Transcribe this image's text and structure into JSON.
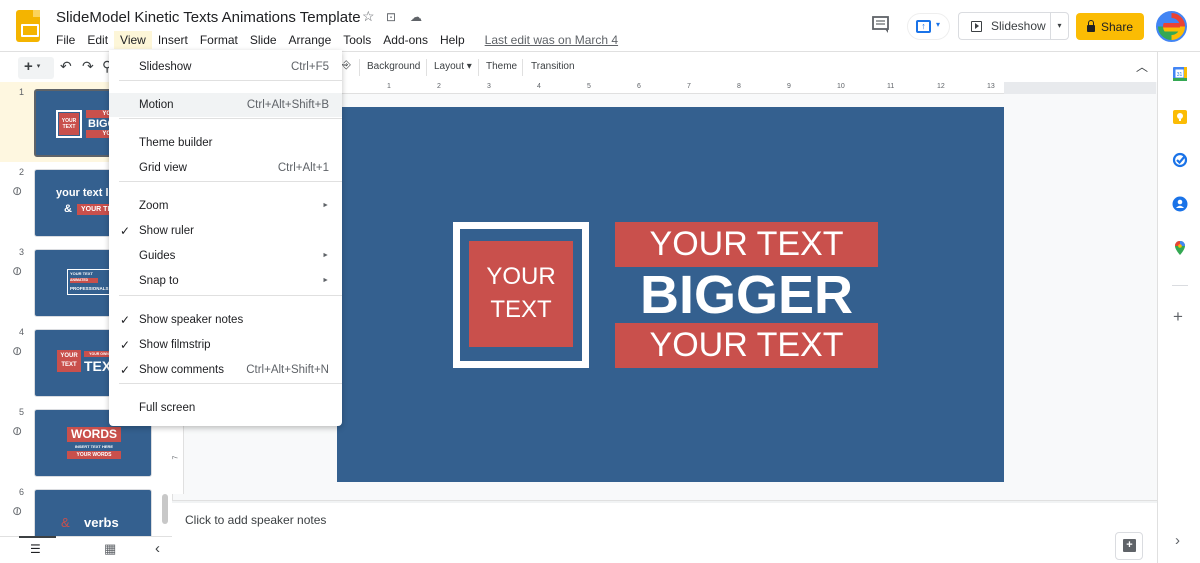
{
  "header": {
    "title": "SlideModel Kinetic Texts Animations Template",
    "title_icons": [
      "star-icon",
      "move-to-folder-icon",
      "cloud-status-icon"
    ],
    "menus": [
      "File",
      "Edit",
      "View",
      "Insert",
      "Format",
      "Slide",
      "Arrange",
      "Tools",
      "Add-ons",
      "Help"
    ],
    "active_menu": "View",
    "last_edit": "Last edit was on March 4",
    "slideshow_label": "Slideshow",
    "share_label": "Share",
    "glyphs": {
      "star": "☆",
      "folder": "⊡",
      "cloud": "☁",
      "comment": "▤",
      "caret": "▾",
      "present_arrow": "↑"
    }
  },
  "toolbar": {
    "new_glyph": "+",
    "new_caret": "▾",
    "undo_glyph": "↶",
    "redo_glyph": "↷",
    "paint_glyph": "⚲",
    "insert_glyph": "⎆",
    "background_label": "Background",
    "layout_label": "Layout ▾",
    "theme_label": "Theme",
    "transition_label": "Transition",
    "collapse_glyph": "︿"
  },
  "ruler": {
    "h_labels": [
      "1",
      "2",
      "3",
      "4",
      "5",
      "6",
      "7",
      "8",
      "9",
      "10",
      "11",
      "12",
      "13"
    ],
    "v_labels": [
      "7"
    ]
  },
  "view_menu": {
    "items": [
      {
        "label": "Slideshow",
        "shortcut": "Ctrl+F5",
        "checked": false,
        "submenu": false
      },
      {
        "label": "Motion",
        "shortcut": "Ctrl+Alt+Shift+B",
        "checked": false,
        "submenu": false,
        "hover": true
      },
      {
        "label": "Theme builder",
        "shortcut": "",
        "checked": false,
        "submenu": false
      },
      {
        "label": "Grid view",
        "shortcut": "Ctrl+Alt+1",
        "checked": false,
        "submenu": false
      },
      {
        "label": "Zoom",
        "shortcut": "",
        "checked": false,
        "submenu": true
      },
      {
        "label": "Show ruler",
        "shortcut": "",
        "checked": true,
        "submenu": false
      },
      {
        "label": "Guides",
        "shortcut": "",
        "checked": false,
        "submenu": true
      },
      {
        "label": "Snap to",
        "shortcut": "",
        "checked": false,
        "submenu": true
      },
      {
        "label": "Show speaker notes",
        "shortcut": "",
        "checked": true,
        "submenu": false
      },
      {
        "label": "Show filmstrip",
        "shortcut": "",
        "checked": true,
        "submenu": false
      },
      {
        "label": "Show comments",
        "shortcut": "Ctrl+Alt+Shift+N",
        "checked": true,
        "submenu": false
      },
      {
        "label": "Full screen",
        "shortcut": "",
        "checked": false,
        "submenu": false
      }
    ],
    "check_glyph": "✓",
    "arrow_glyph": "►"
  },
  "filmstrip": {
    "selected": 1,
    "link_glyph": "⊘",
    "slides": [
      {
        "num": "1",
        "linked": false,
        "texts": [
          "YOUR TEXT",
          "YOUR",
          "BIGG",
          "YOUR"
        ]
      },
      {
        "num": "2",
        "linked": true,
        "texts": [
          "your text l",
          "&",
          "YOUR TE"
        ]
      },
      {
        "num": "3",
        "linked": true,
        "texts": [
          "YOUR TEXT",
          "ANIMATED",
          "PROFESSIONALS"
        ]
      },
      {
        "num": "4",
        "linked": true,
        "texts": [
          "YOUR",
          "TEXT",
          "YOUR OWN",
          "TEXT"
        ]
      },
      {
        "num": "5",
        "linked": true,
        "texts": [
          "WORDS",
          "INSERT TEXT HERE",
          "YOUR WORDS"
        ]
      },
      {
        "num": "6",
        "linked": true,
        "texts": [
          "&",
          "verbs"
        ]
      }
    ],
    "footer": {
      "list_glyph": "☰",
      "grid_glyph": "▦",
      "collapse_glyph": "‹"
    }
  },
  "slide": {
    "box_text_1": "YOUR",
    "box_text_2": "TEXT",
    "banner_top": "YOUR TEXT",
    "bigger": "BIGGER",
    "banner_bottom": "YOUR TEXT",
    "colors": {
      "background": "#34608f",
      "accent": "#c9504c",
      "text": "#ffffff"
    }
  },
  "notes": {
    "placeholder": "Click to add speaker notes"
  },
  "side_panel": {
    "icons": [
      "calendar-icon",
      "keep-icon",
      "tasks-icon",
      "contacts-icon",
      "maps-icon",
      "add-addon-icon"
    ],
    "calendar_text": "31",
    "plus_glyph": "+",
    "expand_glyph": "›"
  },
  "colors": {
    "share": "#fbbc04",
    "blue": "#1a73e8",
    "menu_highlight": "#fdf6d8"
  }
}
